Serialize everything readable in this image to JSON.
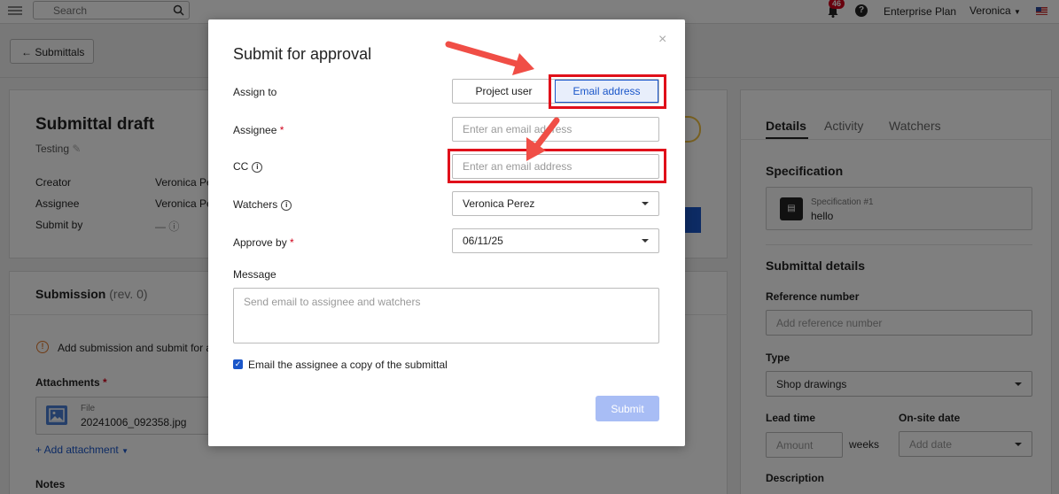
{
  "topbar": {
    "search_placeholder": "Search",
    "notification_count": "46",
    "help_label": "?",
    "plan": "Enterprise Plan",
    "user": "Veronica"
  },
  "page": {
    "back_label": "Submittals",
    "draft_title": "Submittal draft",
    "draft_subtitle": "Testing",
    "creator_label": "Creator",
    "creator_value": "Veronica Pe",
    "assignee_label": "Assignee",
    "assignee_value": "Veronica Pe",
    "submit_by_label": "Submit by",
    "submit_by_value": "—",
    "submission_title": "Submission",
    "submission_rev": "(rev. 0)",
    "submission_notice": "Add submission and submit for ap",
    "attachments_label": "Attachments",
    "file_label": "File",
    "file_name": "20241006_092358.jpg",
    "add_attachment": "+ Add attachment",
    "notes_label": "Notes"
  },
  "right_panel": {
    "tabs": [
      "Details",
      "Activity",
      "Watchers"
    ],
    "specification_title": "Specification",
    "spec_ref": "Specification #1",
    "spec_name": "hello",
    "submittal_details_title": "Submittal details",
    "reference_label": "Reference number",
    "reference_placeholder": "Add reference number",
    "type_label": "Type",
    "type_value": "Shop drawings",
    "lead_time_label": "Lead time",
    "lead_time_placeholder": "Amount",
    "lead_time_unit": "weeks",
    "onsite_label": "On-site date",
    "onsite_placeholder": "Add date",
    "description_label": "Description"
  },
  "modal": {
    "title": "Submit for approval",
    "close": "×",
    "assign_to_label": "Assign to",
    "assign_options": [
      "Project user",
      "Email address"
    ],
    "assign_selected": "Email address",
    "assignee_label": "Assignee",
    "assignee_placeholder": "Enter an email address",
    "cc_label": "CC",
    "cc_placeholder": "Enter an email address",
    "watchers_label": "Watchers",
    "watchers_value": "Veronica Perez",
    "approve_by_label": "Approve by",
    "approve_by_value": "06/11/25",
    "message_label": "Message",
    "message_placeholder": "Send email to assignee and watchers",
    "email_copy_label": "Email the assignee a copy of the submittal",
    "email_copy_checked": true,
    "submit_label": "Submit"
  },
  "colors": {
    "primary": "#1a56c9",
    "annotation_red": "#e0101a",
    "arrow": "#f04e46"
  }
}
